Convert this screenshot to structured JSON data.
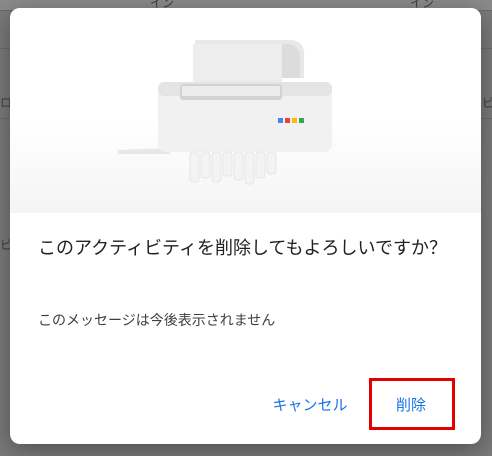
{
  "dialog": {
    "title": "このアクティビティを削除してもよろしいですか？",
    "message": "このメッセージは今後表示されません",
    "buttons": {
      "cancel": "キャンセル",
      "delete": "削除"
    },
    "illustration": "paper-shredder-illustration"
  },
  "background_fragments": [
    "イン",
    "イン",
    "ビ",
    "ロ",
    "ビ"
  ],
  "colors": {
    "accent": "#1a73e8",
    "highlight": "#e00000",
    "dialog_background": "#ffffff"
  }
}
